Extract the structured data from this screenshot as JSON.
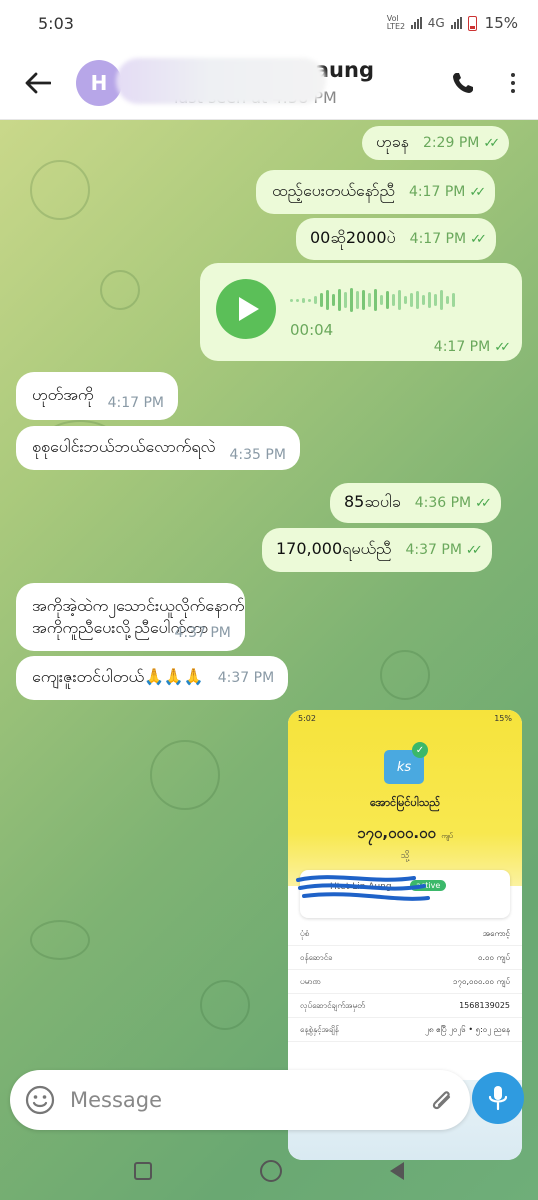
{
  "status_bar": {
    "time": "5:03",
    "network_label": "Vol LTE2",
    "network_type": "4G",
    "battery": "15%"
  },
  "header": {
    "avatar_initial": "H",
    "contact_name": "aung",
    "last_seen": "last seen at 4:58 PM",
    "back_icon": "arrow-left-icon",
    "call_icon": "phone-icon",
    "menu_icon": "more-vertical-icon"
  },
  "messages": [
    {
      "text": "ဟုခန",
      "time": "2:29 PM",
      "direction": "out",
      "read": true
    },
    {
      "text": "ထည့်ပေးတယ်နော်ညီ",
      "time": "4:17 PM",
      "direction": "out",
      "read": true
    },
    {
      "text": "00ဆို2000ပဲ",
      "time": "4:17 PM",
      "direction": "out",
      "read": true
    },
    {
      "type": "voice",
      "duration": "00:04",
      "time": "4:17 PM",
      "direction": "out",
      "read": true
    },
    {
      "text": "ဟုတ်အကို",
      "time": "4:17 PM",
      "direction": "in"
    },
    {
      "text": "စုစုပေါင်းဘယ်ဘယ်လောက်ရလဲ",
      "time": "4:35 PM",
      "direction": "in"
    },
    {
      "text": "85ဆပါခ",
      "time": "4:36 PM",
      "direction": "out",
      "read": true
    },
    {
      "text": "170,000ရမယ်ညီ",
      "time": "4:37 PM",
      "direction": "out",
      "read": true
    },
    {
      "text_line1": "အကိုအဲ့ထဲက၂သောင်းယူလိုက်နောက်",
      "text_line2": "အကိုကူညီပေးလို့ညီပေါက်တာ",
      "time": "4:37 PM",
      "direction": "in"
    },
    {
      "text": "ကျေးဇူးတင်ပါတယ်🙏🙏🙏",
      "time": "4:37 PM",
      "direction": "in"
    }
  ],
  "photo": {
    "status_time": "5:02",
    "status_right": "15%",
    "logo_text": "ks",
    "title": "အောင်မြင်ပါသည်",
    "amount": "၁၇၀,၀၀၀.၀၀",
    "amount_unit": "ကျပ်",
    "sub": "သို့",
    "card_name": "Htet Lin Aung",
    "card_badge": "active",
    "rows": [
      {
        "label": "ပုံစံ",
        "value": "အကောင့်"
      },
      {
        "label": "ဝန်ဆောင်ခ",
        "value": "၀.၀၀ ကျပ်"
      },
      {
        "label": "ပမာဏ",
        "value": "၁၇၀,၀၀၀.၀၀ ကျပ်"
      },
      {
        "label": "လုပ်ဆောင်ချက်အမှတ်",
        "value": "1568139025"
      },
      {
        "label": "နေ့စွဲနှင့်အချိန်",
        "value": "၂၈ ဧပြီ ၂၀၂၆ • ၅:၀၂ ညနေ"
      }
    ]
  },
  "input": {
    "placeholder": "Message",
    "emoji_icon": "smile-icon",
    "attach_icon": "paperclip-icon",
    "mic_icon": "microphone-icon"
  },
  "colors": {
    "outgoing_bubble": "#ecfad8",
    "incoming_bubble": "#ffffff",
    "accent_green": "#5bbf58",
    "mic_blue": "#2f9be0"
  }
}
